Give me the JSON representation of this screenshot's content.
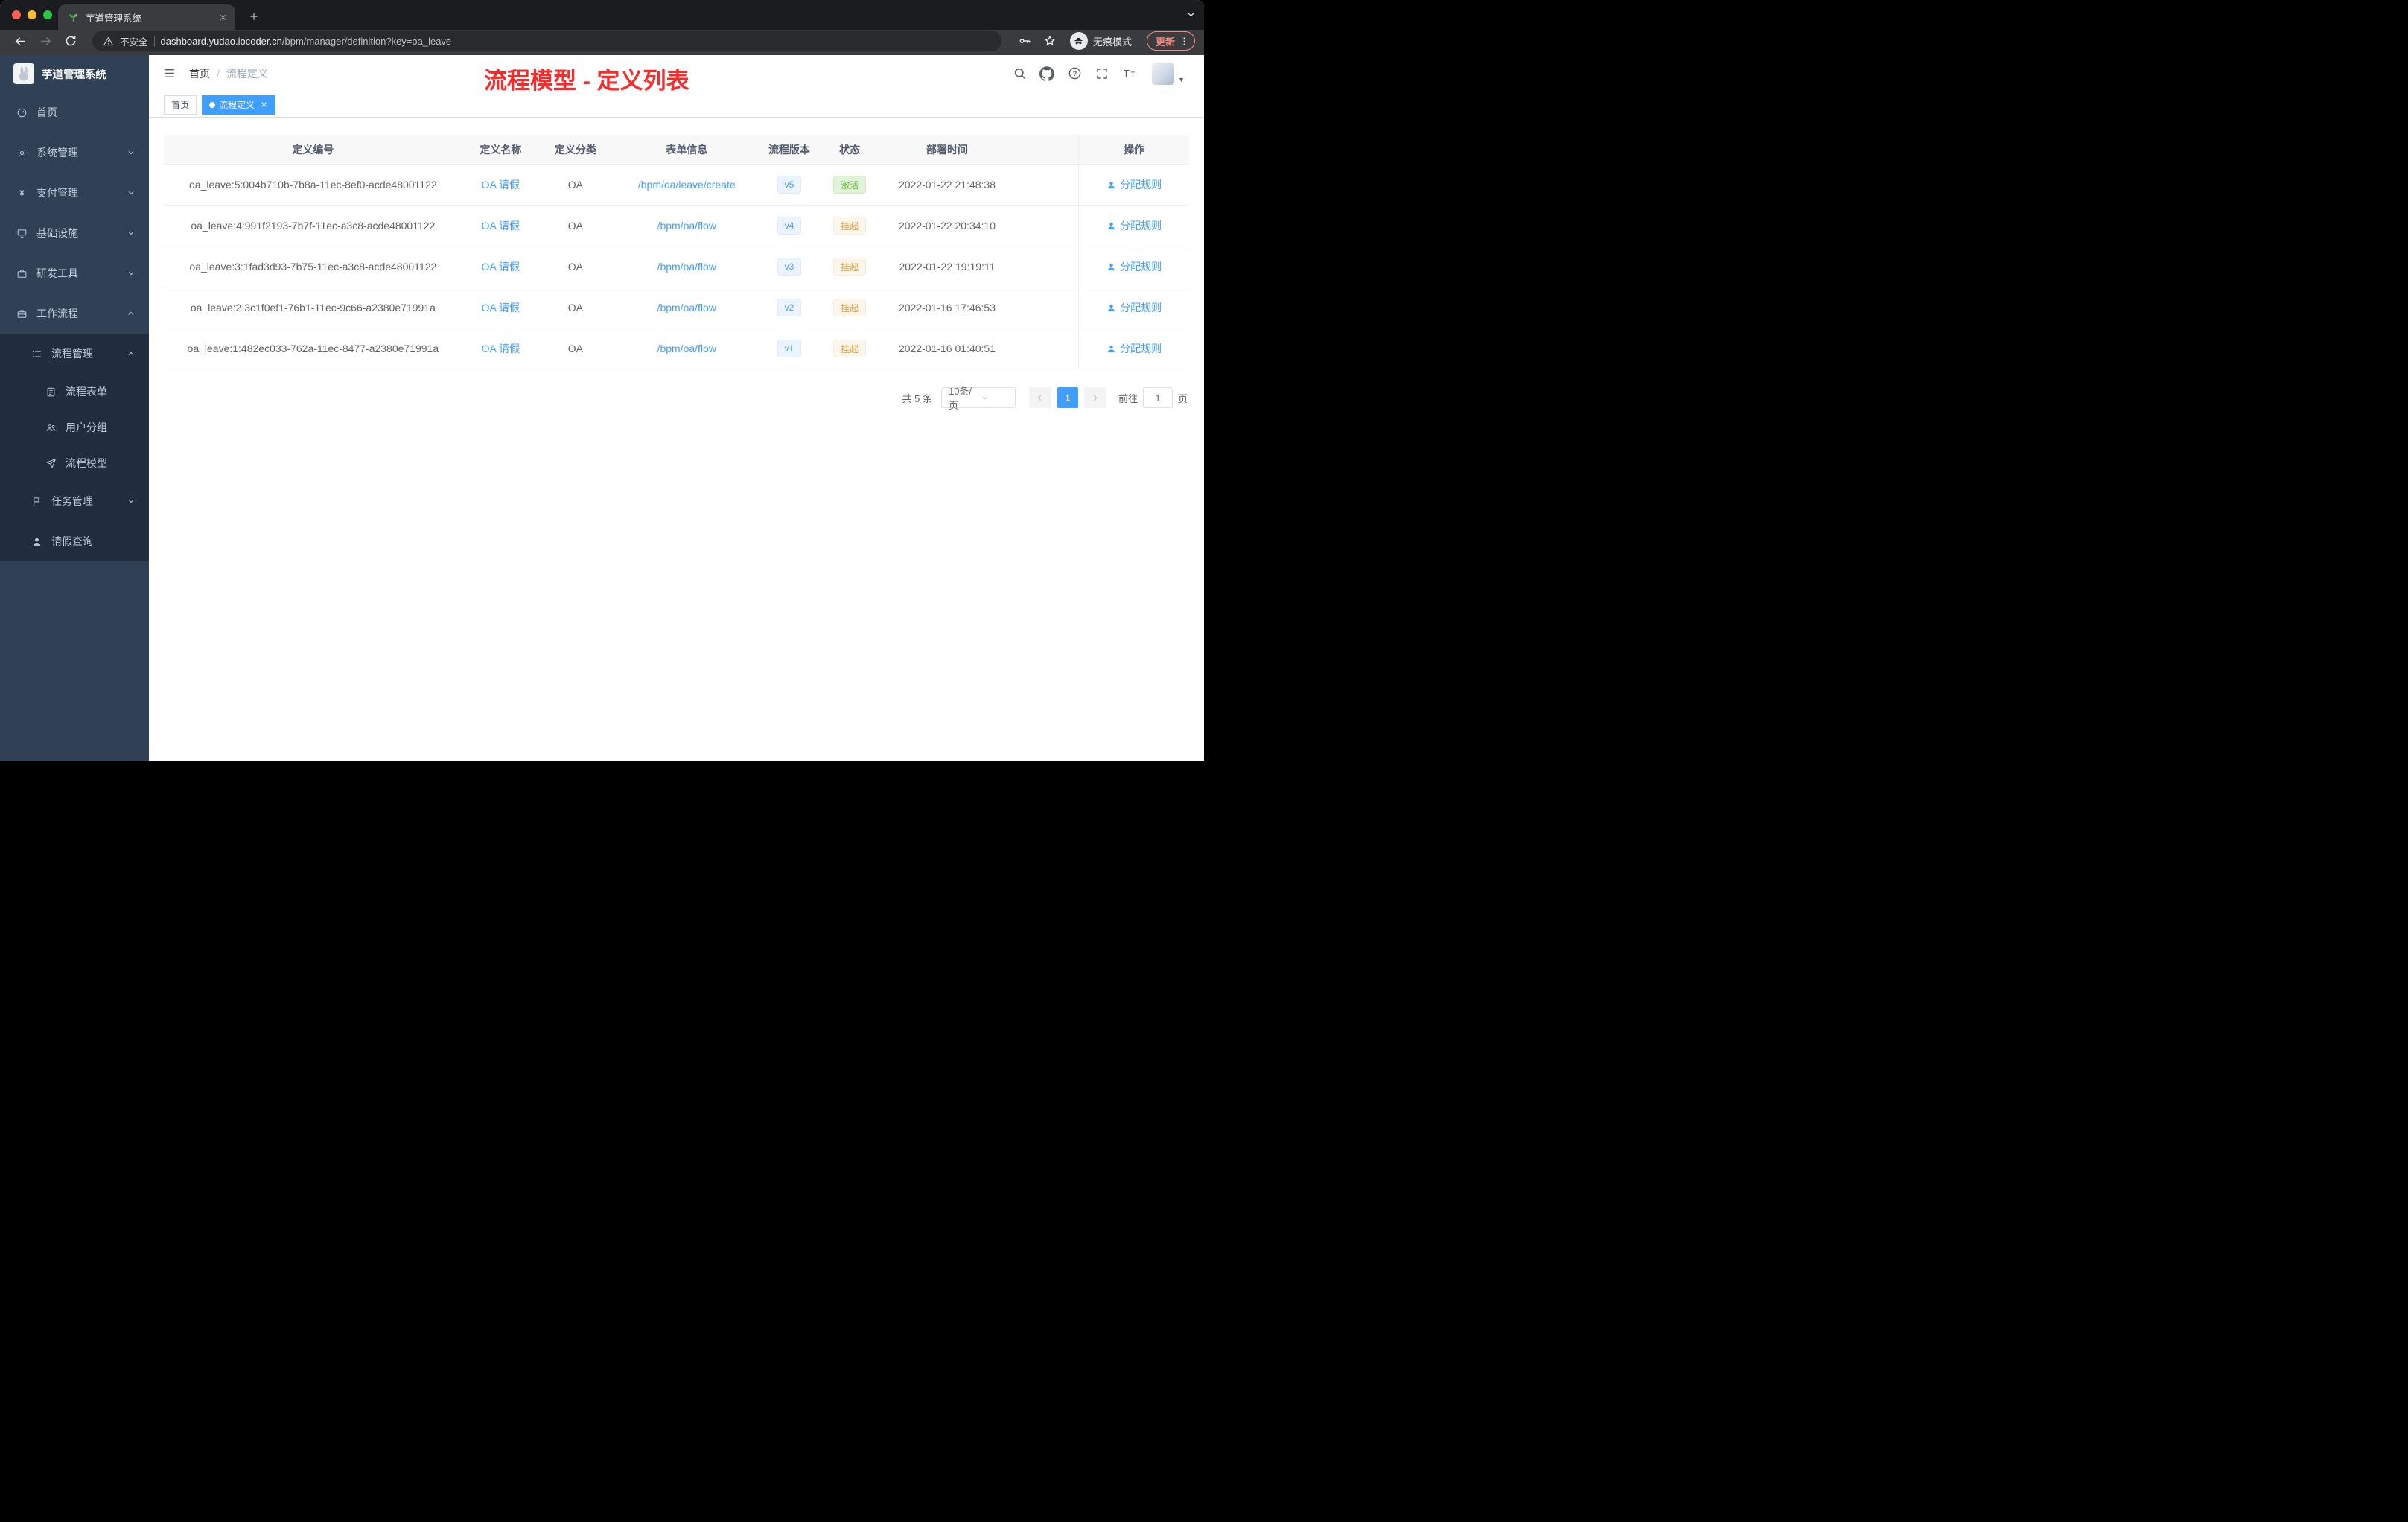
{
  "browser": {
    "tab_title": "芋道管理系统",
    "security_label": "不安全",
    "url_host": "dashboard.yudao.iocoder.cn",
    "url_path": "/bpm/manager/definition?key=oa_leave",
    "incognito_label": "无痕模式",
    "update_label": "更新"
  },
  "sidebar": {
    "logo_title": "芋道管理系统",
    "menu": [
      {
        "label": "首页",
        "level": 1
      },
      {
        "label": "系统管理",
        "level": 1,
        "arrow": "down"
      },
      {
        "label": "支付管理",
        "level": 1,
        "arrow": "down"
      },
      {
        "label": "基础设施",
        "level": 1,
        "arrow": "down"
      },
      {
        "label": "研发工具",
        "level": 1,
        "arrow": "down"
      },
      {
        "label": "工作流程",
        "level": 1,
        "arrow": "up",
        "expanded": true
      },
      {
        "label": "流程管理",
        "level": 2,
        "arrow": "up",
        "expanded": true
      },
      {
        "label": "流程表单",
        "level": 3
      },
      {
        "label": "用户分组",
        "level": 3
      },
      {
        "label": "流程模型",
        "level": 3
      },
      {
        "label": "任务管理",
        "level": 2,
        "arrow": "down"
      },
      {
        "label": "请假查询",
        "level": 2
      }
    ]
  },
  "header": {
    "breadcrumb": [
      "首页",
      "流程定义"
    ],
    "separator": "/",
    "annotation": "流程模型 - 定义列表"
  },
  "tags": [
    {
      "label": "首页",
      "active": false
    },
    {
      "label": "流程定义",
      "active": true
    }
  ],
  "table": {
    "columns": [
      "定义编号",
      "定义名称",
      "定义分类",
      "表单信息",
      "流程版本",
      "状态",
      "部署时间",
      "操作"
    ],
    "rows": [
      {
        "id": "oa_leave:5:004b710b-7b8a-11ec-8ef0-acde48001122",
        "name": "OA 请假",
        "category": "OA",
        "form": "/bpm/oa/leave/create",
        "version": "v5",
        "status": "激活",
        "status_type": "success",
        "deploy_time": "2022-01-22 21:48:38",
        "action": "分配规则"
      },
      {
        "id": "oa_leave:4:991f2193-7b7f-11ec-a3c8-acde48001122",
        "name": "OA 请假",
        "category": "OA",
        "form": "/bpm/oa/flow",
        "version": "v4",
        "status": "挂起",
        "status_type": "warning",
        "deploy_time": "2022-01-22 20:34:10",
        "action": "分配规则"
      },
      {
        "id": "oa_leave:3:1fad3d93-7b75-11ec-a3c8-acde48001122",
        "name": "OA 请假",
        "category": "OA",
        "form": "/bpm/oa/flow",
        "version": "v3",
        "status": "挂起",
        "status_type": "warning",
        "deploy_time": "2022-01-22 19:19:11",
        "action": "分配规则"
      },
      {
        "id": "oa_leave:2:3c1f0ef1-76b1-11ec-9c66-a2380e71991a",
        "name": "OA 请假",
        "category": "OA",
        "form": "/bpm/oa/flow",
        "version": "v2",
        "status": "挂起",
        "status_type": "warning",
        "deploy_time": "2022-01-16 17:46:53",
        "action": "分配规则"
      },
      {
        "id": "oa_leave:1:482ec033-762a-11ec-8477-a2380e71991a",
        "name": "OA 请假",
        "category": "OA",
        "form": "/bpm/oa/flow",
        "version": "v1",
        "status": "挂起",
        "status_type": "warning",
        "deploy_time": "2022-01-16 01:40:51",
        "action": "分配规则"
      }
    ]
  },
  "pagination": {
    "total_label": "共 5 条",
    "page_size": "10条/页",
    "current_page": "1",
    "goto_label": "前往",
    "goto_value": "1",
    "page_unit": "页"
  },
  "colors": {
    "accent_blue": "#409eff",
    "success_green": "#67c23a",
    "warning_orange": "#e6a23c",
    "annotation_red": "#fb2a2a",
    "sidebar_bg": "#304156",
    "submenu_bg": "#1f2d3d",
    "incognito_update_red": "#f28b82"
  },
  "icons": {
    "tab_favicon": "seedling-icon",
    "toolbar": [
      "back-icon",
      "forward-icon",
      "reload-icon",
      "warning-icon",
      "key-icon",
      "star-icon",
      "incognito-icon",
      "more-vertical-icon"
    ],
    "navbar": [
      "hamburger-icon",
      "search-icon",
      "github-icon",
      "question-icon",
      "fullscreen-icon",
      "font-size-icon",
      "caret-down-icon"
    ],
    "sidebar": [
      "dashboard-icon",
      "gear-icon",
      "yen-icon",
      "infrastructure-icon",
      "toolbox-icon",
      "workflow-icon",
      "process-list-icon",
      "form-icon",
      "user-group-icon",
      "send-icon",
      "task-flag-icon",
      "user-icon"
    ],
    "table_action": "user-icon"
  }
}
